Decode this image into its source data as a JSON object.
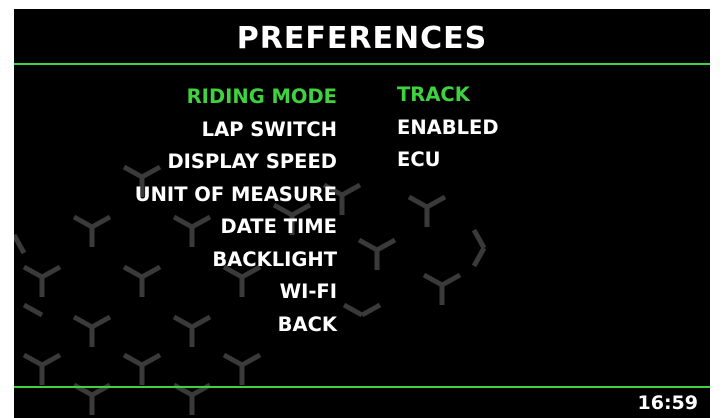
{
  "header": {
    "title": "PREFERENCES"
  },
  "menu": {
    "items": [
      {
        "label": "RIDING MODE",
        "selected": true
      },
      {
        "label": "LAP SWITCH",
        "selected": false
      },
      {
        "label": "DISPLAY SPEED",
        "selected": false
      },
      {
        "label": "UNIT OF MEASURE",
        "selected": false
      },
      {
        "label": "DATE TIME",
        "selected": false
      },
      {
        "label": "BACKLIGHT",
        "selected": false
      },
      {
        "label": "WI-FI",
        "selected": false
      },
      {
        "label": "BACK",
        "selected": false
      }
    ]
  },
  "values": {
    "riding_mode": "TRACK",
    "lap_switch": "ENABLED",
    "display_speed": "ECU"
  },
  "status_bar": {
    "clock": "16:59"
  },
  "colors": {
    "background": "#000000",
    "accent": "#3fd23f",
    "text": "#ffffff",
    "pattern": "#3a3a3a"
  }
}
